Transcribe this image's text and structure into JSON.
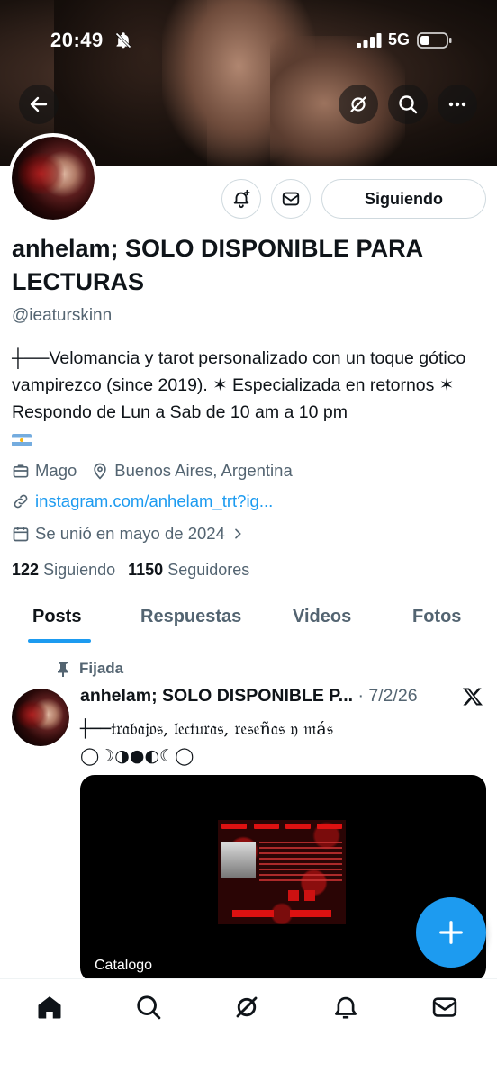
{
  "status_bar": {
    "time": "20:49",
    "network": "5G"
  },
  "profile": {
    "display_name": "anhelam; SOLO DISPONIBLE PARA LECTURAS",
    "handle": "@ieaturskinn",
    "bio": "┼──Velomancia y tarot personalizado con un toque gótico vampirezco (since 2019). ✶ Especializada en retornos ✶ Respondo de Lun a Sab de 10 am a 10 pm",
    "category": "Mago",
    "location": "Buenos Aires, Argentina",
    "link": "instagram.com/anhelam_trt?ig...",
    "joined": "Se unió en mayo de 2024",
    "following_count": "122",
    "following_label": "Siguiendo",
    "followers_count": "1150",
    "followers_label": "Seguidores"
  },
  "actions": {
    "follow_label": "Siguiendo"
  },
  "tabs": [
    {
      "label": "Posts",
      "active": true
    },
    {
      "label": "Respuestas",
      "active": false
    },
    {
      "label": "Videos",
      "active": false
    },
    {
      "label": "Fotos",
      "active": false
    }
  ],
  "post": {
    "pinned_label": "Fijada",
    "author": "anhelam; SOLO DISPONIBLE P...",
    "date": "· 7/2/26",
    "text_line1": "┼──𝔱𝔯𝔞𝔟𝔞𝔧𝔬𝔰, 𝔩𝔢𝔠𝔱𝔲𝔯𝔞𝔰, 𝔯𝔢𝔰𝔢ñ𝔞𝔰 𝔶 𝔪á𝔰",
    "text_line2": "◯☽◑●◐☾◯",
    "media_caption": "Catalogo"
  },
  "colors": {
    "accent": "#1d9bf0",
    "text": "#0f1419",
    "muted": "#536471"
  }
}
